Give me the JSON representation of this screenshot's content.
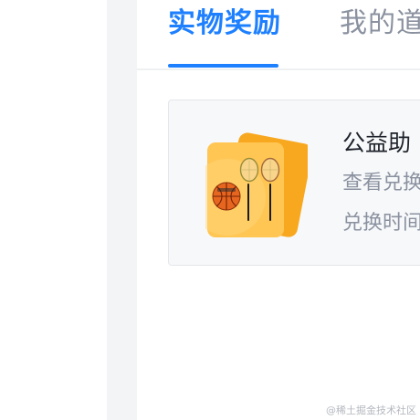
{
  "tabs": [
    {
      "label": "实物奖励",
      "active": true
    },
    {
      "label": "我的道",
      "active": false
    }
  ],
  "card": {
    "title": "公益助",
    "line1": "查看兑换",
    "line2": "兑换时间",
    "image_icon": "basketball-badminton-prize-icon"
  },
  "watermark": "@稀土掘金技术社区",
  "colors": {
    "accent": "#1e80ff",
    "inactive_text": "#8a919f",
    "card_background": "#f7f8fa",
    "gutter": "#f3f4f5"
  }
}
